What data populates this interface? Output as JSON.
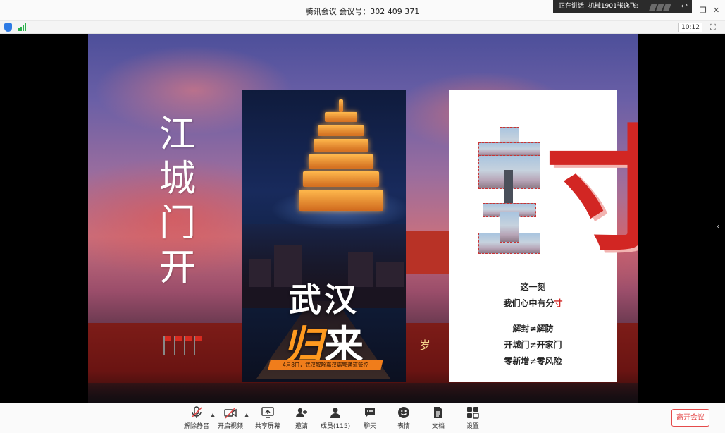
{
  "window": {
    "title": "腾讯会议 会议号：302 409 371",
    "speaking": "正在讲话: 机械1901张逸飞;",
    "time": "10:12"
  },
  "slide": {
    "vertical_title": "江城门开",
    "poster1": {
      "title_line1": "武汉",
      "title_line2_a": "归",
      "title_line2_b": "来",
      "caption": "4月8日，武汉解除离汉离鄂通道管控"
    },
    "poster2": {
      "lines": [
        "这一刻",
        "我们心中有分",
        "解封≠解防",
        "开城门≠开家门",
        "零新增≠零风险"
      ],
      "big_char": "寸",
      "line2_red": "寸"
    },
    "bg_signs": [
      "岁"
    ]
  },
  "toolbar": {
    "items": [
      {
        "label": "解除静音",
        "icon": "mic-muted-icon"
      },
      {
        "label": "开启视频",
        "icon": "video-off-icon"
      },
      {
        "label": "共享屏幕",
        "icon": "share-screen-icon"
      },
      {
        "label": "邀请",
        "icon": "invite-user-icon"
      },
      {
        "label": "成员(115)",
        "icon": "members-icon"
      },
      {
        "label": "聊天",
        "icon": "chat-icon"
      },
      {
        "label": "表情",
        "icon": "emoji-icon"
      },
      {
        "label": "文档",
        "icon": "document-icon"
      },
      {
        "label": "设置",
        "icon": "settings-icon"
      }
    ],
    "leave": "离开会议"
  },
  "colors": {
    "accent_red": "#e54b4b",
    "poster_red": "#d22623",
    "poster_orange": "#f07d1b"
  }
}
